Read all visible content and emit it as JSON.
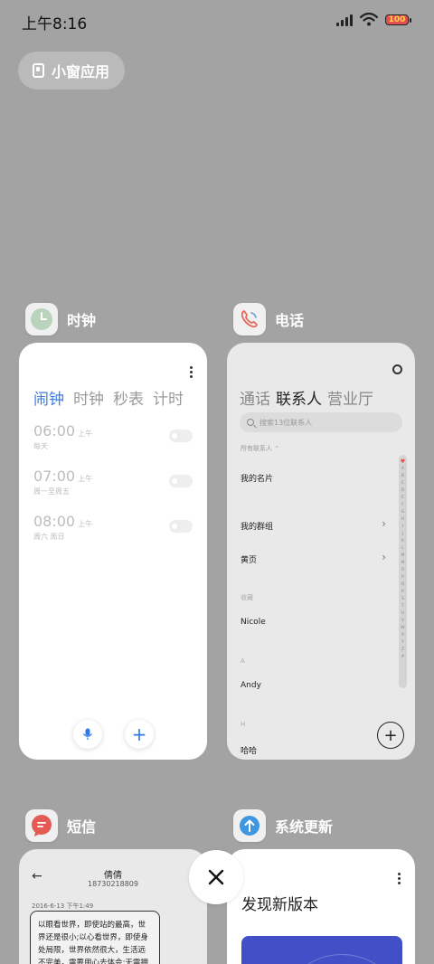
{
  "status_bar": {
    "time": "上午8:16",
    "battery": "100",
    "icons": [
      "signal-icon",
      "wifi-icon",
      "battery-icon"
    ]
  },
  "small_window": {
    "label": "小窗应用"
  },
  "apps": {
    "clock": {
      "name": "时钟",
      "tabs": [
        "闹钟",
        "时钟",
        "秒表",
        "计时"
      ],
      "active_tab": "闹钟",
      "alarms": [
        {
          "time": "06:00",
          "ampm": "上午",
          "repeat": "每天"
        },
        {
          "time": "07:00",
          "ampm": "上午",
          "repeat": "周一至周五"
        },
        {
          "time": "08:00",
          "ampm": "上午",
          "repeat": "周六 周日"
        }
      ],
      "add_symbol": "+"
    },
    "phone": {
      "name": "电话",
      "tabs": [
        "通话",
        "联系人",
        "营业厅"
      ],
      "active_tab": "联系人",
      "search_placeholder": "搜索13位联系人",
      "filter": "所有联系人 ⌃",
      "my_card": "我的名片",
      "my_groups": "我的群组",
      "yellow_pages": "黄页",
      "favorites_header": "收藏",
      "favorite": "Nicole",
      "section_a": "A",
      "contact_a": "Andy",
      "section_h": "H",
      "contact_h": "哈哈",
      "index_letters": [
        "A",
        "B",
        "C",
        "D",
        "E",
        "F",
        "G",
        "H",
        "I",
        "J",
        "K",
        "L",
        "M",
        "N",
        "O",
        "P",
        "Q",
        "R",
        "S",
        "T",
        "U",
        "V",
        "W",
        "X",
        "Y",
        "Z",
        "#"
      ],
      "add_symbol": "+"
    },
    "sms": {
      "name": "短信",
      "contact_name": "倩倩",
      "contact_number": "18730218809",
      "date": "2016-6-13 下午1:49",
      "message": "以眼看世界，即使站的最高，世界还是很小;以心看世界，即使身处局限，世界依然很大，生活远不完美，需要用心去体会;无需拥有太"
    },
    "update": {
      "name": "系统更新",
      "title": "发现新版本"
    }
  },
  "close_all": {
    "symbol": "✕"
  },
  "colors": {
    "background": "#a3a3a3",
    "accent_blue": "#3a7ce6",
    "clock_icon_bg": "#b9d3bd",
    "phone_icon": "#e46a5f",
    "sms_icon": "#e35b54",
    "update_icon": "#3e97e0",
    "update_banner": "#4250c7"
  }
}
